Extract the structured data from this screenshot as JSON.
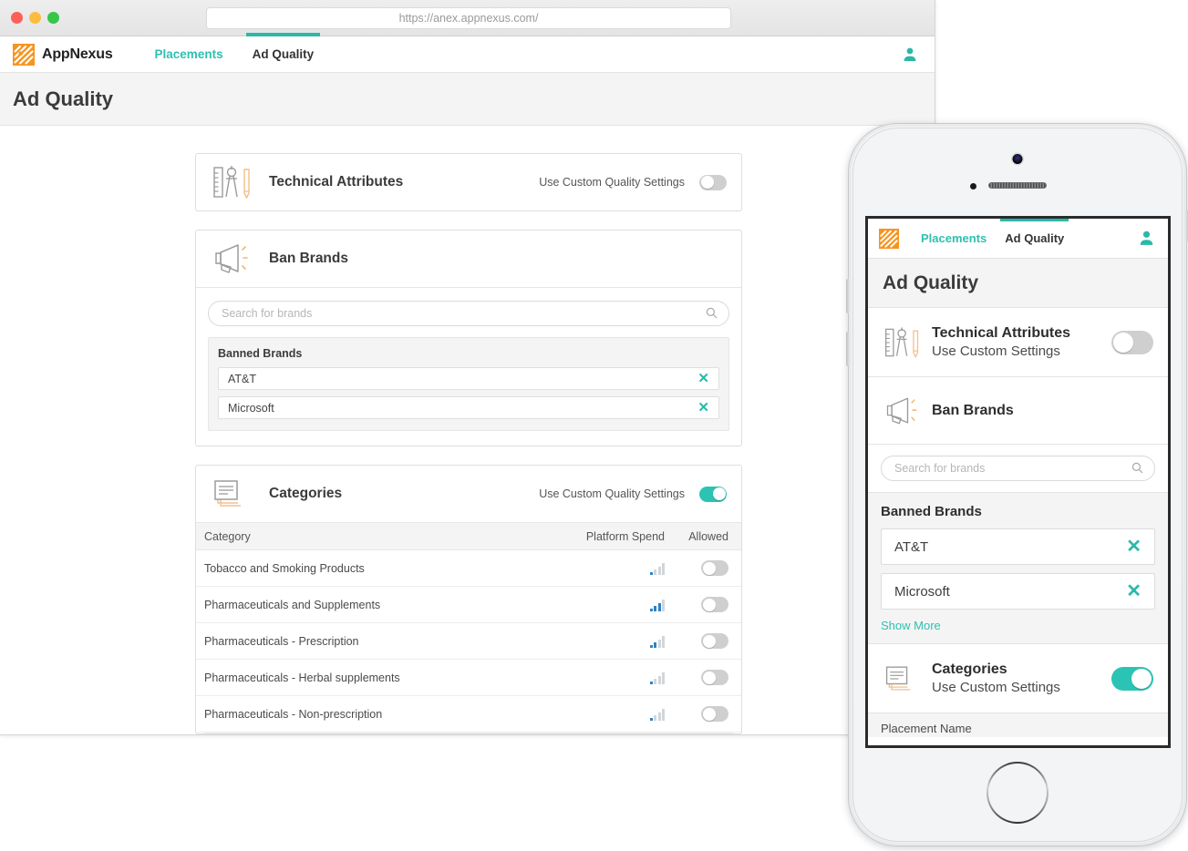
{
  "browser": {
    "url": "https://anex.appnexus.com/",
    "traffic_lights": [
      "close",
      "minimize",
      "zoom"
    ]
  },
  "desktop": {
    "brand": "AppNexus",
    "nav": [
      {
        "label": "Placements",
        "active": false
      },
      {
        "label": "Ad Quality",
        "active": true
      }
    ],
    "user_icon": "user-avatar-icon",
    "page_title": "Ad Quality",
    "cards": {
      "technical": {
        "title": "Technical Attributes",
        "toggle_label": "Use Custom Quality Settings",
        "toggle_on": false,
        "icon": "ruler-compass-pencil-icon"
      },
      "ban_brands": {
        "title": "Ban Brands",
        "icon": "megaphone-icon",
        "search_placeholder": "Search for brands",
        "search_value": "",
        "banned_title": "Banned Brands",
        "brands": [
          "AT&T",
          "Microsoft"
        ],
        "remove_glyph": "✕"
      },
      "categories": {
        "title": "Categories",
        "icon": "documents-stack-icon",
        "toggle_label": "Use Custom Quality Settings",
        "toggle_on": true,
        "columns": [
          "Category",
          "Platform Spend",
          "Allowed"
        ],
        "rows": [
          {
            "name": "Tobacco and Smoking Products",
            "spend_level": 1,
            "allowed": false
          },
          {
            "name": "Pharmaceuticals and Supplements",
            "spend_level": 3,
            "allowed": false
          },
          {
            "name": "Pharmaceuticals - Prescription",
            "spend_level": 2,
            "allowed": false
          },
          {
            "name": "Pharmaceuticals - Herbal supplements",
            "spend_level": 1,
            "allowed": false
          },
          {
            "name": "Pharmaceuticals - Non-prescription",
            "spend_level": 1,
            "allowed": false
          }
        ]
      }
    }
  },
  "phone": {
    "nav": [
      {
        "label": "Placements",
        "active": false
      },
      {
        "label": "Ad Quality",
        "active": true
      }
    ],
    "user_icon": "user-avatar-icon",
    "page_title": "Ad Quality",
    "technical": {
      "title": "Technical Attributes",
      "subtitle": "Use Custom Settings",
      "toggle_on": false
    },
    "ban_brands": {
      "title": "Ban Brands",
      "search_placeholder": "Search for brands",
      "search_value": "",
      "banned_title": "Banned Brands",
      "brands": [
        "AT&T",
        "Microsoft"
      ],
      "show_more": "Show More",
      "remove_glyph": "✕"
    },
    "categories": {
      "title": "Categories",
      "subtitle": "Use Custom Settings",
      "toggle_on": true
    },
    "next_section_label": "Placement Name"
  },
  "colors": {
    "teal": "#2bb8a8",
    "teal_toggle": "#2bc4b4",
    "orange": "#f7941e",
    "spend_blue": "#2f82c4",
    "spend_grey": "#d2d6da"
  }
}
